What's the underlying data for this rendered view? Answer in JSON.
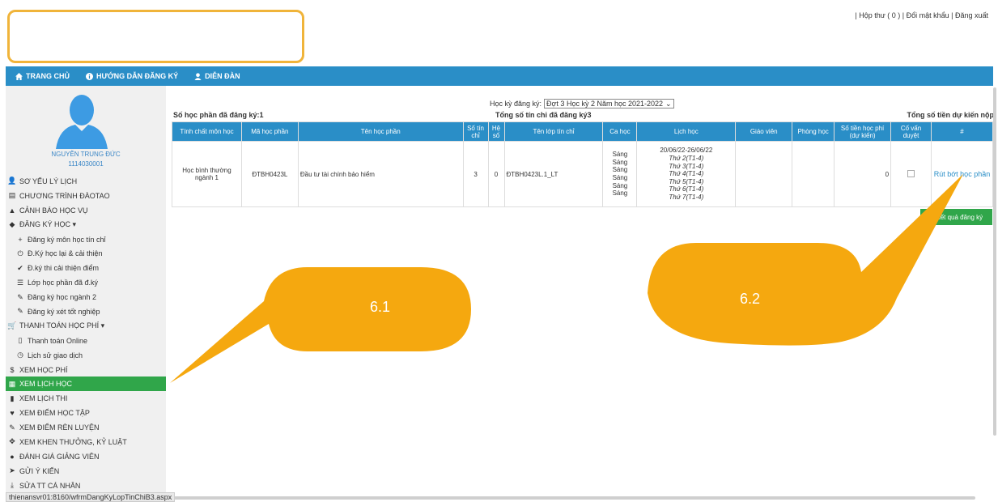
{
  "header": {
    "top_links": "| Hộp thư ( 0 ) | Đổi mật khẩu | Đăng xuất"
  },
  "nav": {
    "items": [
      {
        "label": "TRANG CHỦ",
        "icon": "home-icon"
      },
      {
        "label": "HƯỚNG DẪN ĐĂNG KÝ",
        "icon": "info-icon"
      },
      {
        "label": "DIỄN ĐÀN",
        "icon": "user-icon"
      }
    ]
  },
  "student": {
    "name": "NGUYỄN TRUNG ĐỨC",
    "id": "1114030001"
  },
  "sidebar": {
    "items": [
      {
        "label": "SƠ YẾU LÝ LỊCH",
        "icon": "user-icon",
        "glyph": "👤",
        "sub": false
      },
      {
        "label": "CHƯƠNG TRÌNH ĐÀOTAO",
        "icon": "list-icon",
        "glyph": "▤",
        "sub": false
      },
      {
        "label": "CẢNH BÁO HỌC VỤ",
        "icon": "warning-icon",
        "glyph": "▲",
        "sub": false
      },
      {
        "label": "ĐĂNG KÝ HỌC ▾",
        "icon": "tag-icon",
        "glyph": "◆",
        "sub": false
      },
      {
        "label": "Đăng ký môn học tín chỉ",
        "icon": "plus-icon",
        "glyph": "+",
        "sub": true
      },
      {
        "label": "Đ.Ký học lại & cải thiện",
        "icon": "power-icon",
        "glyph": "⏻",
        "sub": true
      },
      {
        "label": "Đ.ký thi cải thiện điểm",
        "icon": "check-icon",
        "glyph": "✔",
        "sub": true
      },
      {
        "label": "Lớp học phần đã đ.ký",
        "icon": "list-icon",
        "glyph": "☰",
        "sub": true
      },
      {
        "label": "Đăng ký học ngành 2",
        "icon": "pencil-icon",
        "glyph": "✎",
        "sub": true
      },
      {
        "label": "Đăng ký xét tốt nghiệp",
        "icon": "pencil-icon",
        "glyph": "✎",
        "sub": true
      },
      {
        "label": "THANH TOÁN HỌC PHÍ ▾",
        "icon": "cart-icon",
        "glyph": "🛒",
        "sub": false
      },
      {
        "label": "Thanh toán Online",
        "icon": "phone-icon",
        "glyph": "▯",
        "sub": true
      },
      {
        "label": "Lịch sử giao dịch",
        "icon": "clock-icon",
        "glyph": "◷",
        "sub": true
      },
      {
        "label": "XEM HỌC PHÍ",
        "icon": "dollar-icon",
        "glyph": "$",
        "sub": false
      },
      {
        "label": "XEM LỊCH HỌC",
        "icon": "calendar-icon",
        "glyph": "▦",
        "sub": false,
        "active": true
      },
      {
        "label": "XEM LỊCH THI",
        "icon": "file-icon",
        "glyph": "▮",
        "sub": false
      },
      {
        "label": "XEM ĐIỂM HỌC TẬP",
        "icon": "heart-icon",
        "glyph": "♥",
        "sub": false
      },
      {
        "label": "XEM ĐIỂM RÈN LUYỆN",
        "icon": "pencil-icon",
        "glyph": "✎",
        "sub": false
      },
      {
        "label": "XEM KHEN THƯỞNG, KỶ LUẬT",
        "icon": "move-icon",
        "glyph": "✥",
        "sub": false
      },
      {
        "label": "ĐÁNH GIÁ GIẢNG VIÊN",
        "icon": "circle-icon",
        "glyph": "●",
        "sub": false
      },
      {
        "label": "GỬI Ý KIẾN",
        "icon": "send-icon",
        "glyph": "➤",
        "sub": false
      },
      {
        "label": "SỬA TT CÁ NHÂN",
        "icon": "download-icon",
        "glyph": "⤓",
        "sub": false
      }
    ]
  },
  "status_url": "thienansvr01:8160/wfrmDangKyLopTinChiB3.aspx",
  "registration": {
    "semester_label": "Học kỳ đăng ký:",
    "semester_value": "Đợt 3 Học kỳ 2 Năm học 2021-2022",
    "count_courses": "Số học phần đã đăng ký:1",
    "count_credits": "Tổng số tín chỉ đã đăng ký3",
    "expected_fee_label": "Tổng số tiền dự kiến nộp",
    "columns": [
      "Tính chất môn học",
      "Mã học phần",
      "Tên học phần",
      "Số tín chỉ",
      "Hệ số",
      "Tên lớp tín chỉ",
      "Ca học",
      "Lịch học",
      "Giáo viên",
      "Phòng học",
      "Số tiền học phí (dự kiến)",
      "Cố vấn duyệt",
      "#"
    ],
    "row": {
      "type": "Học bình thường ngành 1",
      "code": "ĐTBH0423L",
      "name": "Đầu tư tài chính bảo hiểm",
      "credits": "3",
      "coef": "0",
      "class": "ĐTBH0423L.1_LT",
      "shifts": [
        "Sáng",
        "Sáng",
        "Sáng",
        "Sáng",
        "Sáng",
        "Sáng"
      ],
      "date_range": "20/06/22-26/06/22",
      "schedule": [
        "Thứ 2(T1-4)",
        "Thứ 3(T1-4)",
        "Thứ 4(T1-4)",
        "Thứ 5(T1-4)",
        "Thứ 6(T1-4)",
        "Thứ 7(T1-4)"
      ],
      "teacher": "",
      "room": "",
      "fee": "0",
      "withdraw": "Rút bớt học phần"
    },
    "print_button": "In kết quả đăng ký"
  },
  "callouts": [
    {
      "label": "6.1"
    },
    {
      "label": "6.2"
    }
  ],
  "colors": {
    "nav": "#2a8ec7",
    "active": "#30a64a",
    "callout": "#f5a80f",
    "logo_border": "#f0b43a"
  }
}
